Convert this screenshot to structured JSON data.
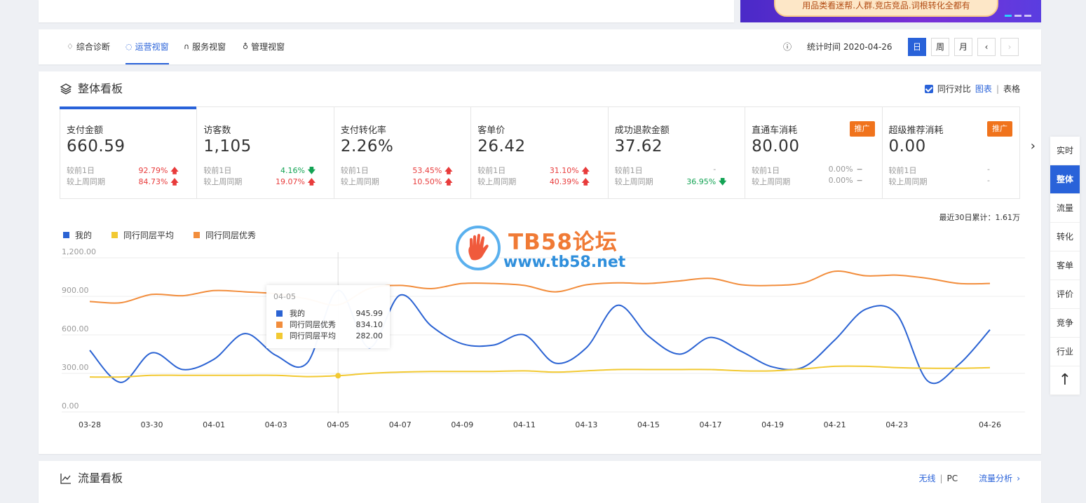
{
  "banner": {
    "text": "用品类看迷帮.人群.竞店竞品.词根转化全都有"
  },
  "nav": {
    "tabs": [
      {
        "label": "综合诊断",
        "icon": "diagnosis-icon"
      },
      {
        "label": "运营视窗",
        "icon": "operation-icon",
        "active": true
      },
      {
        "label": "服务视窗",
        "icon": "headset-icon"
      },
      {
        "label": "管理视窗",
        "icon": "medal-icon"
      }
    ],
    "stat_time_label": "统计时间 2020-04-26",
    "period_buttons": [
      "日",
      "周",
      "月"
    ],
    "prev": "‹",
    "next": "›"
  },
  "overview": {
    "title": "整体看板",
    "compare_label": "同行对比",
    "view_chart": "图表",
    "view_sep": "|",
    "view_table": "表格",
    "row_labels": [
      "较前1日",
      "较上周同期"
    ],
    "metrics": [
      {
        "label": "支付金额",
        "value": "660.59",
        "d1": "92.79%",
        "d1_dir": "up",
        "w1": "84.73%",
        "w1_dir": "up",
        "active": true
      },
      {
        "label": "访客数",
        "value": "1,105",
        "d1": "4.16%",
        "d1_dir": "down",
        "w1": "19.07%",
        "w1_dir": "up"
      },
      {
        "label": "支付转化率",
        "value": "2.26%",
        "d1": "53.45%",
        "d1_dir": "up",
        "w1": "10.50%",
        "w1_dir": "up"
      },
      {
        "label": "客单价",
        "value": "26.42",
        "d1": "31.10%",
        "d1_dir": "up",
        "w1": "40.39%",
        "w1_dir": "up"
      },
      {
        "label": "成功退款金额",
        "value": "37.62",
        "d1": "-",
        "d1_dir": "none",
        "w1": "36.95%",
        "w1_dir": "down"
      },
      {
        "label": "直通车消耗",
        "value": "80.00",
        "d1": "0.00%",
        "d1_dir": "flat",
        "w1": "0.00%",
        "w1_dir": "flat",
        "badge": "推广"
      },
      {
        "label": "超级推荐消耗",
        "value": "0.00",
        "d1": "-",
        "d1_dir": "none",
        "w1": "-",
        "w1_dir": "none",
        "badge": "推广"
      }
    ],
    "cumulative": "最近30日累计：1.61万"
  },
  "chart_data": {
    "type": "line",
    "x": [
      "03-28",
      "03-29",
      "03-30",
      "03-31",
      "04-01",
      "04-02",
      "04-03",
      "04-04",
      "04-05",
      "04-06",
      "04-07",
      "04-08",
      "04-09",
      "04-10",
      "04-11",
      "04-12",
      "04-13",
      "04-14",
      "04-15",
      "04-16",
      "04-17",
      "04-18",
      "04-19",
      "04-20",
      "04-21",
      "04-22",
      "04-23",
      "04-24",
      "04-25",
      "04-26"
    ],
    "x_tick_labels": [
      "03-28",
      "03-30",
      "04-01",
      "04-03",
      "04-05",
      "04-07",
      "04-09",
      "04-11",
      "04-13",
      "04-15",
      "04-17",
      "04-19",
      "04-21",
      "04-23",
      "04-26"
    ],
    "y_ticks": [
      "0.00",
      "300.00",
      "600.00",
      "900.00",
      "1,200.00"
    ],
    "ylim": [
      0,
      1200
    ],
    "series": [
      {
        "name": "我的",
        "color": "#2b63d3",
        "values": [
          480,
          230,
          460,
          330,
          410,
          610,
          440,
          380,
          945.99,
          500,
          910,
          670,
          530,
          520,
          600,
          380,
          500,
          830,
          590,
          450,
          580,
          470,
          350,
          350,
          560,
          800,
          760,
          240,
          370,
          640
        ]
      },
      {
        "name": "同行同层平均",
        "color": "#f2c932",
        "values": [
          272,
          272,
          285,
          285,
          285,
          285,
          285,
          275,
          282,
          300,
          310,
          315,
          315,
          315,
          320,
          310,
          320,
          330,
          330,
          330,
          330,
          320,
          320,
          335,
          355,
          355,
          345,
          340,
          340,
          345
        ]
      },
      {
        "name": "同行同层优秀",
        "color": "#f28d3c",
        "values": [
          860,
          850,
          915,
          905,
          945,
          935,
          920,
          880,
          834.1,
          960,
          985,
          960,
          1000,
          1000,
          985,
          935,
          990,
          1005,
          1000,
          1020,
          1040,
          990,
          985,
          1005,
          1095,
          1060,
          1065,
          1040,
          1000,
          1000
        ]
      }
    ],
    "tooltip": {
      "date": "04-05",
      "rows": [
        {
          "name": "我的",
          "value": "945.99",
          "color": "#2b63d3"
        },
        {
          "name": "同行同层优秀",
          "value": "834.10",
          "color": "#f28d3c"
        },
        {
          "name": "同行同层平均",
          "value": "282.00",
          "color": "#f2c932"
        }
      ]
    }
  },
  "watermark": {
    "title": "TB58论坛",
    "url": "www.tb58.net"
  },
  "sidenav": {
    "items": [
      "实时",
      "整体",
      "流量",
      "转化",
      "客单",
      "评价",
      "竞争",
      "行业"
    ],
    "active": "整体",
    "top_icon": "↑"
  },
  "flow": {
    "title": "流量看板",
    "wireless": "无线",
    "sep": "|",
    "pc": "PC",
    "analysis": "流量分析",
    "arrow": "›"
  }
}
